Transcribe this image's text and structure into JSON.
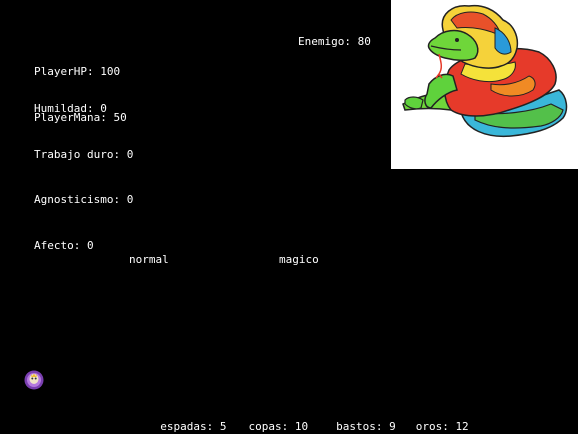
{
  "player": {
    "hp_label": "PlayerHP: 100",
    "mana_label": "PlayerMana: 50"
  },
  "enemy": {
    "hp_label": "Enemigo: 80",
    "portrait": "crocodile-creature-portrait"
  },
  "virtues": {
    "humildad": "Humildad: 0",
    "trabajo_duro": "Trabajo duro: 0",
    "agnosticismo": "Agnosticismo: 0",
    "afecto": "Afecto: 0"
  },
  "actions": {
    "normal": "normal",
    "magic": "magico"
  },
  "token": {
    "icon": "purple-spirit-icon"
  },
  "deck": {
    "espadas": "espadas: 5",
    "copas": "copas: 10",
    "bastos": "bastos: 9",
    "oros": "oros: 12"
  },
  "colors": {
    "background": "#000000",
    "text": "#ffffff",
    "portrait_bg": "#ffffff"
  }
}
